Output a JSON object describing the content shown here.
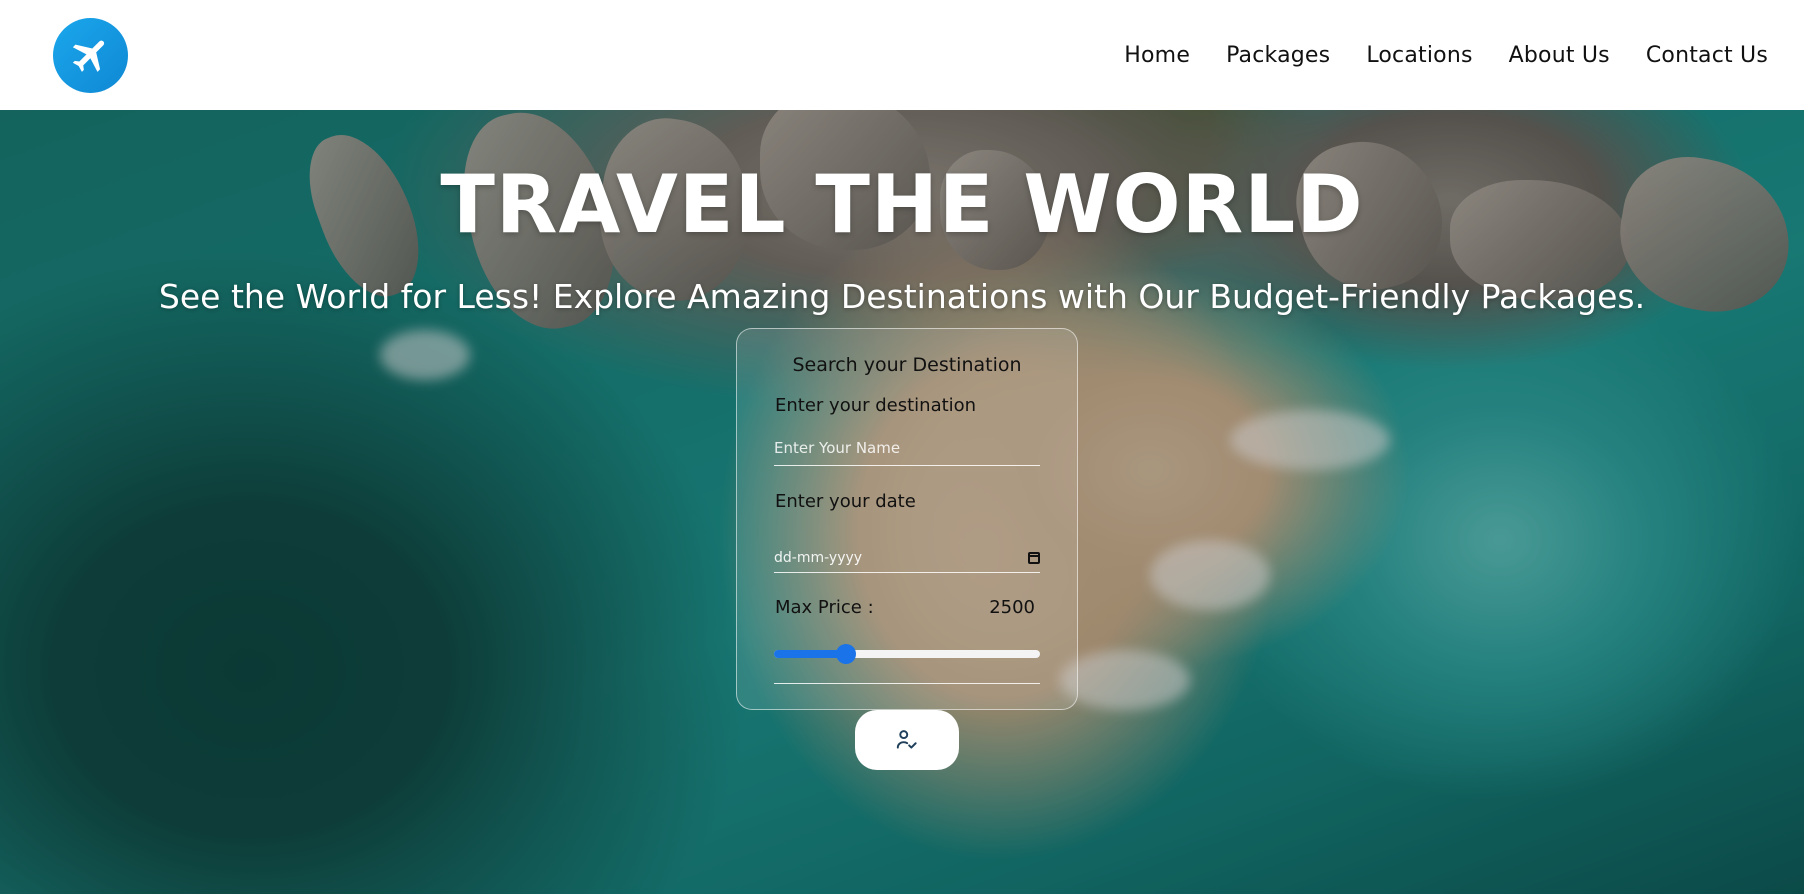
{
  "brand": {
    "logo_icon": "airplane-icon",
    "logo_color": "#1aa7ec"
  },
  "nav": {
    "items": [
      {
        "label": "Home"
      },
      {
        "label": "Packages"
      },
      {
        "label": "Locations"
      },
      {
        "label": "About Us"
      },
      {
        "label": "Contact Us"
      }
    ]
  },
  "hero": {
    "title": "TRAVEL THE WORLD",
    "subtitle": "See the World for Less! Explore Amazing Destinations with Our Budget-Friendly Packages."
  },
  "search": {
    "title": "Search your Destination",
    "destination_label": "Enter your destination",
    "destination_placeholder": "Enter Your Name",
    "date_label": "Enter your date",
    "date_placeholder": "dd-mm-yyyy",
    "price_label": "Max Price :",
    "price_value": "2500",
    "price_slider_fraction": 0.27,
    "slider_color": "#1a73e8",
    "submit_icon": "user-check-icon"
  }
}
